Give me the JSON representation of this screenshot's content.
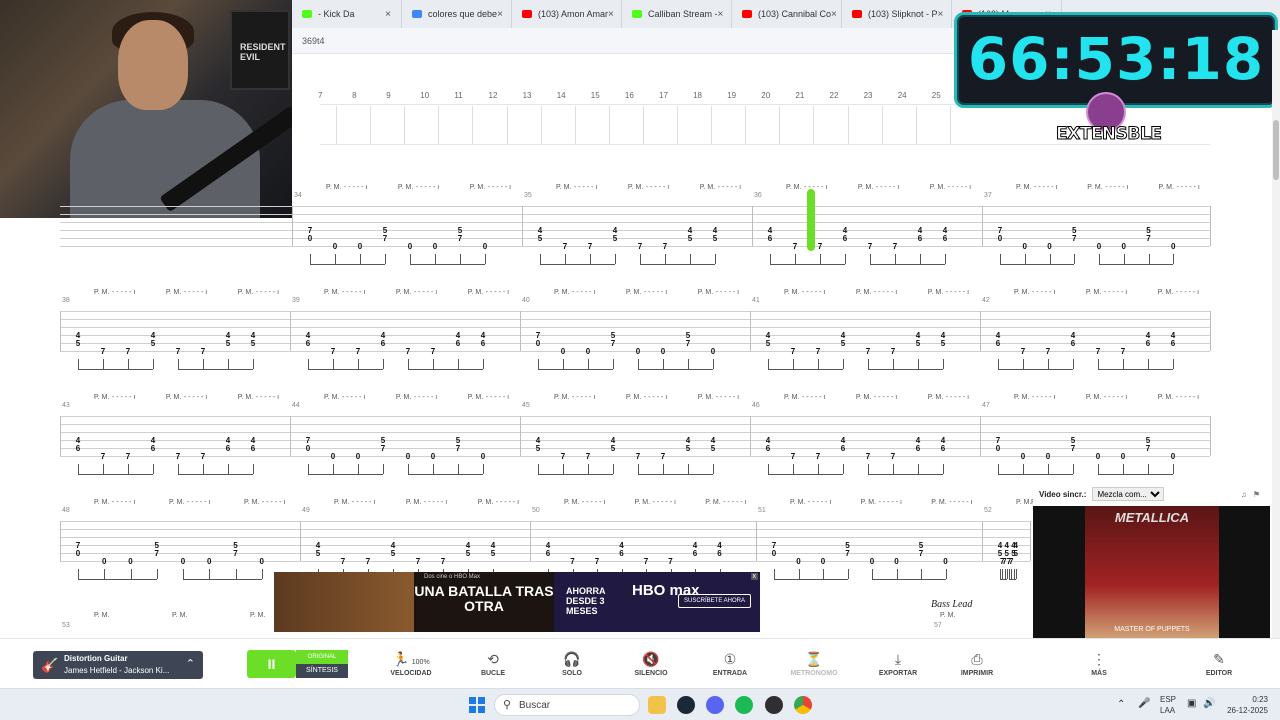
{
  "browser": {
    "tabs": [
      {
        "title": "- Kick Da",
        "color": "#53fc18"
      },
      {
        "title": "colores que debe",
        "color": "#4285f4"
      },
      {
        "title": "(103) Amon Amar",
        "color": "#ff0000"
      },
      {
        "title": "Calliban Stream -",
        "color": "#53fc18"
      },
      {
        "title": "(103) Cannibal Co",
        "color": "#ff0000"
      },
      {
        "title": "(103) Slipknot - P",
        "color": "#ff0000"
      },
      {
        "title": "(103) M",
        "color": "#ff0000"
      }
    ],
    "address_fragment": "369t4"
  },
  "webcam": {
    "poster_text": "RESIDENT EVIL"
  },
  "stream_overlay": {
    "timer": "66:53:18",
    "logo_text": "EXTENSBLE"
  },
  "ruler": {
    "measures": [
      "7",
      "8",
      "9",
      "10",
      "11",
      "12",
      "13",
      "14",
      "15",
      "16",
      "17",
      "18",
      "19",
      "20",
      "21",
      "22",
      "23",
      "24",
      "25"
    ]
  },
  "score": {
    "palm_mute_label": "P. M.",
    "bar_numbers": [
      "34",
      "35",
      "36",
      "37",
      "38",
      "39",
      "40",
      "41",
      "42",
      "43",
      "44",
      "45",
      "46",
      "47",
      "48",
      "49",
      "50",
      "51",
      "52",
      "53",
      "57"
    ],
    "bass_lead_label": "Bass Lead"
  },
  "ad": {
    "top_line": "Dos cine o HBO Max",
    "headline": "UNA BATALLA TRAS OTRA",
    "offer": "AHORRA DESDE 3 MESES",
    "brand": "HBO max",
    "cta": "SUSCRÍBETE AHORA",
    "close": "x"
  },
  "video_panel": {
    "label": "Video sincr.:",
    "select_value": "Mezcla com...",
    "band": "METALLICA",
    "album": "MASTER OF PUPPETS"
  },
  "toolbar": {
    "instrument_name": "Distortion Guitar",
    "instrument_player": "James Hetfield - Jackson Ki...",
    "play_label": "II",
    "mode_original": "ORIGINAL",
    "mode_sintesis": "SÍNTESIS",
    "buttons": [
      {
        "label": "VELOCIDAD",
        "icon": "runner-icon",
        "value": "100%"
      },
      {
        "label": "BUCLE",
        "icon": "loop-icon"
      },
      {
        "label": "SOLO",
        "icon": "headphones-icon"
      },
      {
        "label": "SILENCIO",
        "icon": "mute-icon"
      },
      {
        "label": "ENTRADA",
        "icon": "countin-icon"
      },
      {
        "label": "METRÓNOMO",
        "icon": "metronome-icon"
      },
      {
        "label": "EXPORTAR",
        "icon": "export-icon"
      },
      {
        "label": "IMPRIMIR",
        "icon": "print-icon"
      },
      {
        "label": "MÁS",
        "icon": "more-icon"
      },
      {
        "label": "EDITOR",
        "icon": "editor-icon"
      }
    ]
  },
  "taskbar": {
    "search_placeholder": "Buscar",
    "language": "ESP",
    "region": "LAA",
    "time": "0:23",
    "date": "26-12-2025"
  }
}
